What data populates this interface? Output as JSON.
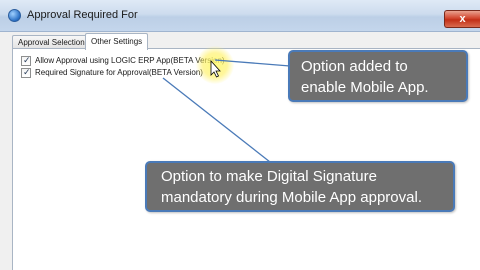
{
  "window": {
    "title": "Approval Required For",
    "close_glyph": "x",
    "icon": "app-icon"
  },
  "tabs": [
    {
      "label": "Approval Selections",
      "active": false
    },
    {
      "label": "Other Settings",
      "active": true
    }
  ],
  "options": [
    {
      "label": "Allow Approval using LOGIC ERP App(BETA Version)",
      "checked": true
    },
    {
      "label": "Required Signature for Approval(BETA Version)",
      "checked": true
    }
  ],
  "callouts": {
    "mobile_app": {
      "line1": "Option added to",
      "line2": "enable Mobile App."
    },
    "signature": {
      "line1": "Option to make Digital Signature",
      "line2": "mandatory during Mobile App approval."
    }
  },
  "colors": {
    "callout_bg": "#6f6f6f",
    "callout_border": "#4a7ab8",
    "cursor_highlight": "#fff35a"
  }
}
